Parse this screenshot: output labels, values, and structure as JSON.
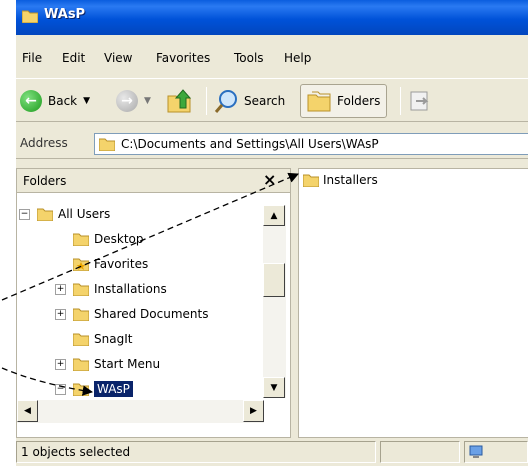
{
  "window": {
    "title": "WAsP"
  },
  "menu": [
    "File",
    "Edit",
    "View",
    "Favorites",
    "Tools",
    "Help"
  ],
  "toolbar": {
    "back_label": "Back",
    "search_label": "Search",
    "folders_label": "Folders"
  },
  "address": {
    "label": "Address",
    "value": "C:\\Documents and Settings\\All Users\\WAsP"
  },
  "folders_pane": {
    "title": "Folders",
    "close_glyph": "×",
    "tree": [
      {
        "label": "All Users",
        "expander": "−"
      },
      {
        "label": "Desktop"
      },
      {
        "label": "Favorites"
      },
      {
        "label": "Installations",
        "expander": "+"
      },
      {
        "label": "Shared Documents",
        "expander": "+"
      },
      {
        "label": "SnagIt"
      },
      {
        "label": "Start Menu",
        "expander": "+"
      },
      {
        "label": "WAsP",
        "expander": "−",
        "selected": true
      }
    ]
  },
  "content": {
    "items": [
      {
        "label": "Installers"
      }
    ]
  },
  "status": {
    "text": "1 objects selected"
  },
  "colors": {
    "title_blue": "#0052d9",
    "selection": "#0a246a",
    "folder_yellow": "#f4d36b",
    "chrome": "#ece9d8"
  }
}
